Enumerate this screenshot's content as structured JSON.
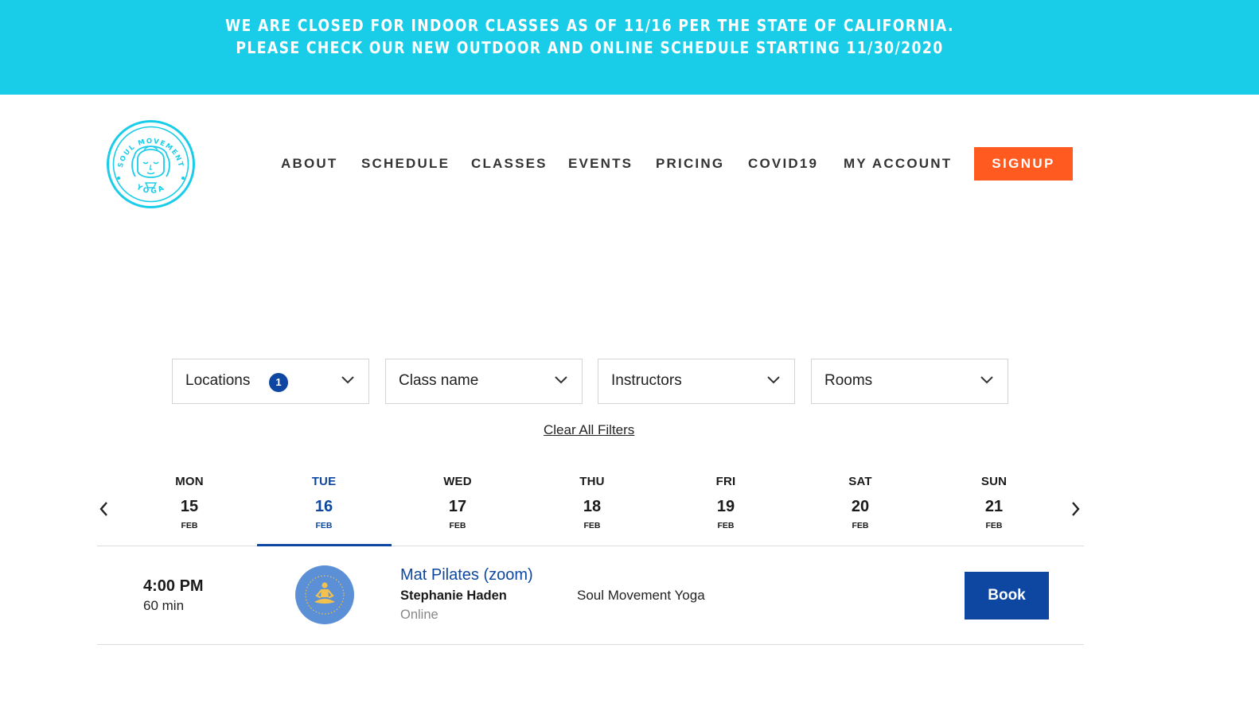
{
  "banner": {
    "line1": "WE ARE CLOSED FOR INDOOR CLASSES AS OF 11/16 PER THE STATE OF CALIFORNIA.",
    "line2": "PLEASE CHECK OUR NEW OUTDOOR AND ONLINE SCHEDULE STARTING 11/30/2020",
    "color": "#19cde9"
  },
  "logo": {
    "arc_top": "SOUL MOVEMENT",
    "arc_bottom": "YOGA",
    "icon": "goddess-face-logo",
    "color": "#19cde9"
  },
  "nav": {
    "items": [
      "ABOUT",
      "SCHEDULE",
      "CLASSES",
      "EVENTS",
      "PRICING",
      "COVID19",
      "MY ACCOUNT"
    ],
    "signup_label": "SIGNUP",
    "signup_color": "#ff5a1f"
  },
  "filters": {
    "locations_label": "Locations",
    "locations_count": "1",
    "class_name_label": "Class name",
    "instructors_label": "Instructors",
    "rooms_label": "Rooms",
    "dropdown_icon": "chevron-down-icon",
    "clear_label": "Clear All Filters"
  },
  "week": {
    "prev_icon": "chevron-left-icon",
    "next_icon": "chevron-right-icon",
    "days": [
      {
        "dow": "MON",
        "num": "15",
        "month": "FEB"
      },
      {
        "dow": "TUE",
        "num": "16",
        "month": "FEB"
      },
      {
        "dow": "WED",
        "num": "17",
        "month": "FEB"
      },
      {
        "dow": "THU",
        "num": "18",
        "month": "FEB"
      },
      {
        "dow": "FRI",
        "num": "19",
        "month": "FEB"
      },
      {
        "dow": "SAT",
        "num": "20",
        "month": "FEB"
      },
      {
        "dow": "SUN",
        "num": "21",
        "month": "FEB"
      }
    ],
    "active_color": "#0d47a1"
  },
  "classes": [
    {
      "time": "4:00 PM",
      "duration": "60 min",
      "icon": "meditation-icon",
      "name": "Mat Pilates (zoom)",
      "instructor": "Stephanie Haden",
      "mode": "Online",
      "studio": "Soul Movement Yoga",
      "book_label": "Book"
    }
  ]
}
